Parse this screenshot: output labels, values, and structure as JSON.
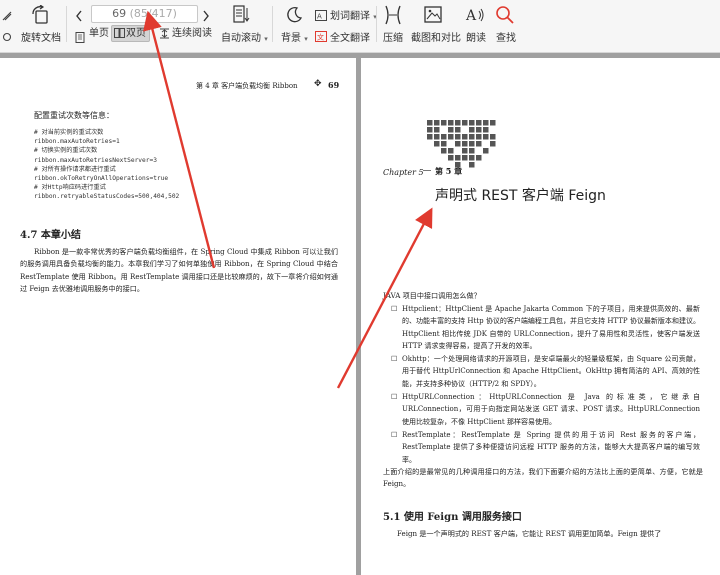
{
  "toolbar": {
    "rotate_label": "旋转文档",
    "page_current": "69",
    "page_total": "(85/417)",
    "single_label": "单页",
    "double_label": "双页",
    "continuous_label": "连续阅读",
    "autoscroll_label": "自动滚动",
    "background_label": "背景",
    "translate_select_label": "划词翻译",
    "translate_all_label": "全文翻译",
    "compress_label": "压缩",
    "screenshot_label": "截图和对比",
    "read_label": "朗读",
    "search_label": "查找",
    "accent_color": "#e03a2f"
  },
  "left_page": {
    "header": "第 4 章   客户端负载均衡 Ribbon",
    "page_number": "69",
    "config_title": "配置重试次数等信息：",
    "code_lines": [
      "# 对当前实例的重试次数",
      "ribbon.maxAutoRetries=1",
      "# 切换实例的重试次数",
      "ribbon.maxAutoRetriesNextServer=3",
      "# 对所有操作请求都进行重试",
      "ribbon.okToRetryOnAllOperations=true",
      "# 对Http响应码进行重试",
      "ribbon.retryableStatusCodes=500,404,502"
    ],
    "section_title": "4.7   本章小结",
    "summary": "Ribbon 是一款非常优秀的客户端负载均衡组件，在 Spring Cloud 中集成 Ribbon 可以让我们的服务调用具备负载均衡的能力。本章我们学习了如何单独使用 Ribbon，在 Spring Cloud 中结合 RestTemplate 使用 Ribbon。用 RestTemplate 调用接口还是比较麻烦的，故下一章将介绍如何通过 Feign 去优雅地调用服务中的接口。"
  },
  "right_page": {
    "chapter_word": "Chapter 5",
    "chapter_label": "第 5 章",
    "chapter_title": "声明式 REST 客户端 Feign",
    "intro": "JAVA 项目中接口调用怎么做？",
    "bullets": [
      "Httpclient：HttpClient 是 Apache Jakarta Common 下的子项目，用来提供高效的、最新的、功能丰富的支持 Http 协议的客户端编程工具包，并且它支持 HTTP 协议最新版本和建议。HttpClient 相比传统 JDK 自带的 URLConnection，提升了易用性和灵活性，使客户端发送 HTTP 请求变得容易，提高了开发的效率。",
      "Okhttp：一个处理网络请求的开源项目，是安卓端最火的轻量级框架，由 Square 公司贡献，用于替代 HttpUrlConnection 和 Apache HttpClient。OkHttp 拥有简洁的 API、高效的性能，并支持多种协议（HTTP/2 和 SPDY）。",
      "HttpURLConnection：HttpURLConnection 是 Java 的标准类，它继承自 URLConnection，可用于向指定网站发送 GET 请求、POST 请求。HttpURLConnection 使用比较复杂，不像 HttpClient 那样容易使用。",
      "RestTemplate：RestTemplate 是 Spring 提供的用于访问 Rest 服务的客户端，RestTemplate 提供了多种便捷访问远程 HTTP 服务的方法，能够大大提高客户端的编写效率。"
    ],
    "after_bullets": "上面介绍的是最常见的几种调用接口的方法，我们下面要介绍的方法比上面的更简单、方便，它就是 Feign。",
    "section_title": "5.1   使用 Feign 调用服务接口",
    "section_text": "Feign 是一个声明式的 REST 客户端，它能让 REST 调用更加简单。Feign 提供了"
  }
}
